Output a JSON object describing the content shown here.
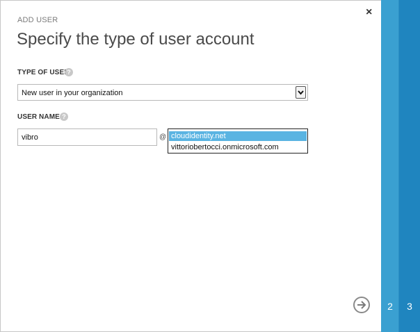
{
  "dialog": {
    "label": "ADD USER",
    "title": "Specify the type of user account",
    "close_glyph": "×",
    "next_glyph": "→"
  },
  "type_of_user": {
    "label": "TYPE OF USER",
    "help_glyph": "?",
    "selected_value": "New user in your organization",
    "arrow_glyph": "⌄"
  },
  "user_name": {
    "label": "USER NAME",
    "help_glyph": "?",
    "value": "vibro",
    "at_sign": "@",
    "domain_options": [
      "cloudidentity.net",
      "vittoriobertocci.onmicrosoft.com"
    ],
    "selected_domain_index": 0
  },
  "steps": [
    {
      "number": "2"
    },
    {
      "number": "3"
    }
  ],
  "colors": {
    "step2": "#3aa0d1",
    "step3": "#1f85bf",
    "selection": "#5ab4e2"
  }
}
